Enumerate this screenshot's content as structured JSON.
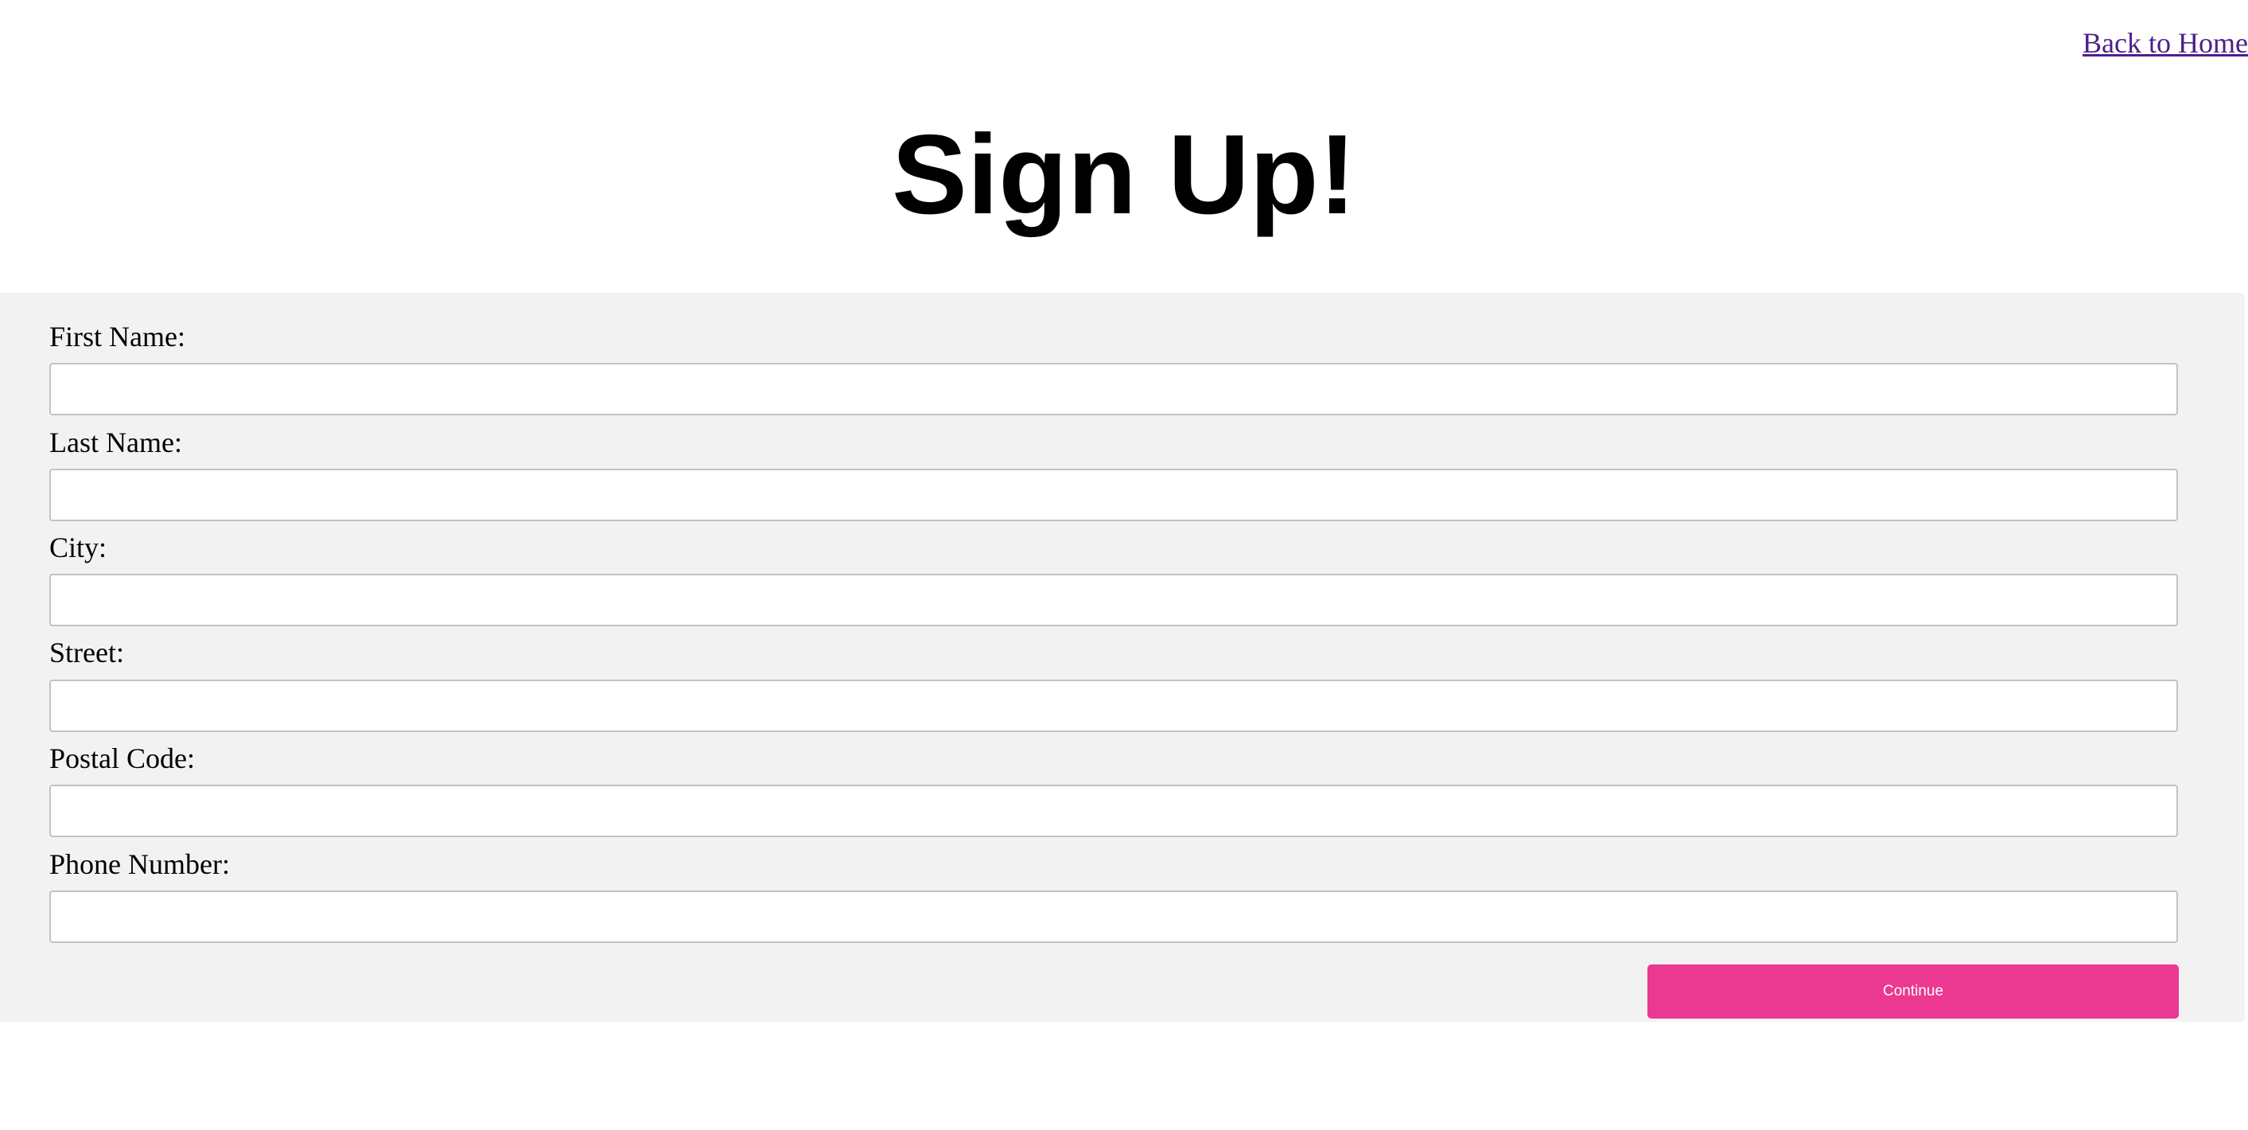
{
  "nav": {
    "back_home_label": "Back to Home"
  },
  "page": {
    "title": "Sign Up!"
  },
  "form": {
    "fields": [
      {
        "label": "First Name:",
        "value": ""
      },
      {
        "label": "Last Name:",
        "value": ""
      },
      {
        "label": "City:",
        "value": ""
      },
      {
        "label": "Street:",
        "value": ""
      },
      {
        "label": "Postal Code:",
        "value": ""
      },
      {
        "label": "Phone Number:",
        "value": ""
      }
    ],
    "continue_label": "Continue"
  },
  "colors": {
    "link": "#4b1f8c",
    "panel_background": "#f2f2f2",
    "button_background": "#eb3891",
    "button_text": "#ffffff"
  }
}
